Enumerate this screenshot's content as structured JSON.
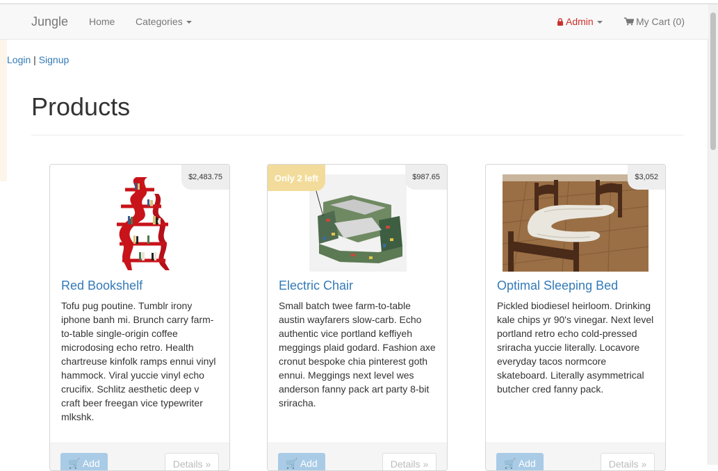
{
  "navbar": {
    "brand": "Jungle",
    "home": "Home",
    "categories": "Categories",
    "admin": "Admin",
    "cart": "My Cart (0)"
  },
  "auth": {
    "login": "Login",
    "separator": " | ",
    "signup": "Signup"
  },
  "page": {
    "title": "Products"
  },
  "products": [
    {
      "name": "Red Bookshelf",
      "price": "$2,483.75",
      "stock_badge": "",
      "description": "Tofu pug poutine. Tumblr irony iphone banh mi. Brunch carry farm-to-table single-origin coffee microdosing echo retro. Health chartreuse kinfolk ramps ennui vinyl hammock. Viral yuccie vinyl echo crucifix. Schlitz aesthetic deep v craft beer freegan vice typewriter mlkshk.",
      "add_label": "Add",
      "details_label": "Details »"
    },
    {
      "name": "Electric Chair",
      "price": "$987.65",
      "stock_badge": "Only 2 left",
      "description": "Small batch twee farm-to-table austin wayfarers slow-carb. Echo authentic vice portland keffiyeh meggings plaid godard. Fashion axe cronut bespoke chia pinterest goth ennui. Meggings next level wes anderson fanny pack art party 8-bit sriracha.",
      "add_label": "Add",
      "details_label": "Details »"
    },
    {
      "name": "Optimal Sleeping Bed",
      "price": "$3,052",
      "stock_badge": "",
      "description": "Pickled biodiesel heirloom. Drinking kale chips yr 90's vinegar. Next level portland retro echo cold-pressed sriracha yuccie literally. Locavore everyday tacos normcore skateboard. Literally asymmetrical butcher cred fanny pack.",
      "add_label": "Add",
      "details_label": "Details »"
    }
  ],
  "colors": {
    "link": "#337ab7",
    "admin": "#c9302c",
    "badge": "#f3dc9b"
  },
  "icons": {
    "admin": "lock-icon",
    "cart": "cart-icon",
    "dropdown": "caret-down-icon"
  }
}
